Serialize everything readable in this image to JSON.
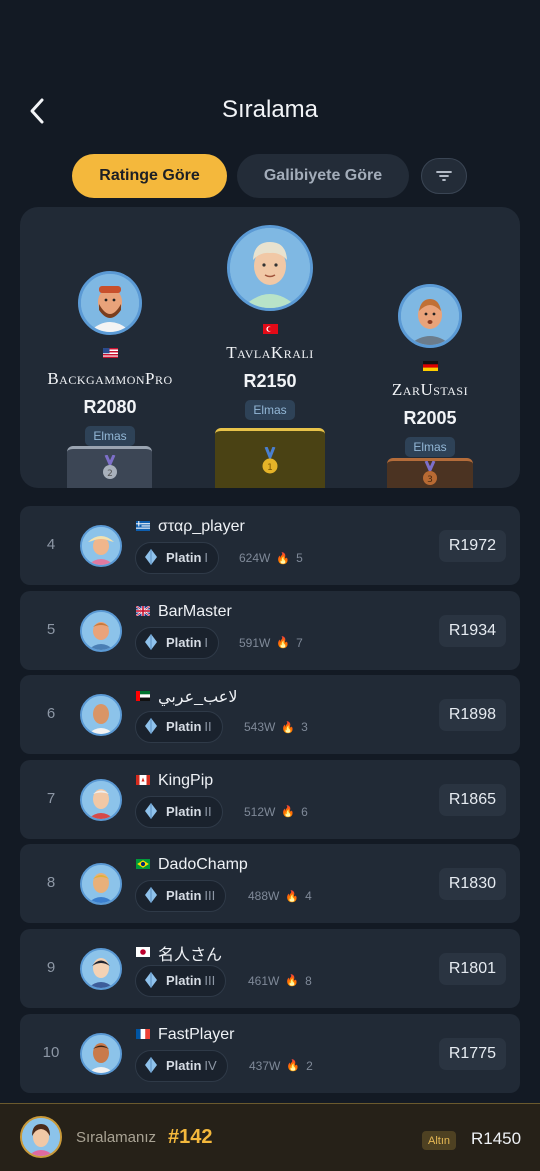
{
  "header": {
    "title": "Sıralama",
    "back_icon": "chevron-left-icon"
  },
  "tabs": {
    "rating": "Ratinge Göre",
    "wins": "Galibiyete Göre",
    "filter_icon": "filter-icon",
    "active": "rating"
  },
  "podium": {
    "first": {
      "name": "TavlaKrali",
      "rating": "R2150",
      "tier": "Elmas",
      "flag": "tr",
      "medal": "1"
    },
    "second": {
      "name": "BackgammonPro",
      "rating": "R2080",
      "tier": "Elmas",
      "flag": "us",
      "medal": "2"
    },
    "third": {
      "name": "ZarUstasi",
      "rating": "R2005",
      "tier": "Elmas",
      "flag": "de",
      "medal": "3"
    }
  },
  "rows": [
    {
      "rank": "4",
      "flag": "gr",
      "name": "σταρ_player",
      "tier": "Platin",
      "division": "I",
      "wins": "624W",
      "streak": "5",
      "rating": "R1972"
    },
    {
      "rank": "5",
      "flag": "gb",
      "name": "BarMaster",
      "tier": "Platin",
      "division": "I",
      "wins": "591W",
      "streak": "7",
      "rating": "R1934"
    },
    {
      "rank": "6",
      "flag": "ae",
      "name": "لاعب_عربي",
      "tier": "Platin",
      "division": "II",
      "wins": "543W",
      "streak": "3",
      "rating": "R1898"
    },
    {
      "rank": "7",
      "flag": "ca",
      "name": "KingPip",
      "tier": "Platin",
      "division": "II",
      "wins": "512W",
      "streak": "6",
      "rating": "R1865"
    },
    {
      "rank": "8",
      "flag": "br",
      "name": "DadoChamp",
      "tier": "Platin",
      "division": "III",
      "wins": "488W",
      "streak": "4",
      "rating": "R1830"
    },
    {
      "rank": "9",
      "flag": "jp",
      "name": "名人さん",
      "tier": "Platin",
      "division": "III",
      "wins": "461W",
      "streak": "8",
      "rating": "R1801"
    },
    {
      "rank": "10",
      "flag": "fr",
      "name": "FastPlayer",
      "tier": "Platin",
      "division": "IV",
      "wins": "437W",
      "streak": "2",
      "rating": "R1775"
    }
  ],
  "me": {
    "label": "Sıralamanız",
    "rank": "#142",
    "tier": "Altın",
    "rating": "R1450"
  },
  "colors": {
    "accent": "#f4b83c",
    "background": "#131a24",
    "card": "#212a36",
    "diamond": "#93b7d6"
  }
}
